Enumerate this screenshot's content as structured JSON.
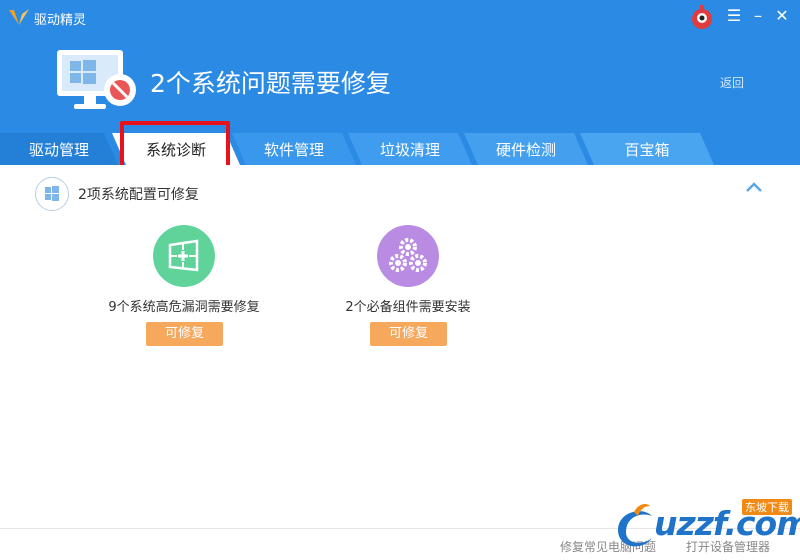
{
  "app": {
    "name": "驱动精灵"
  },
  "hero": {
    "title": "2个系统问题需要修复",
    "back_label": "返回"
  },
  "tabs": [
    {
      "label": "驱动管理"
    },
    {
      "label": "系统诊断",
      "active": true
    },
    {
      "label": "软件管理"
    },
    {
      "label": "垃圾清理"
    },
    {
      "label": "硬件检测"
    },
    {
      "label": "百宝箱"
    }
  ],
  "section": {
    "title": "2项系统配置可修复"
  },
  "cards": [
    {
      "label": "9个系统高危漏洞需要修复",
      "button": "可修复",
      "icon": "windows-shield-icon",
      "color": "#5fd39a"
    },
    {
      "label": "2个必备组件需要安装",
      "button": "可修复",
      "icon": "gears-icon",
      "color": "#b98be3"
    }
  ],
  "footer": {
    "link1": "修复常见电脑问题",
    "link2": "打开设备管理器"
  },
  "watermark": {
    "text": "uzzf.com",
    "tag": "东坡下载"
  },
  "colors": {
    "header": "#2b8ae4",
    "tab_active": "#ffffff",
    "highlight": "#e8131a",
    "button": "#f6a85d"
  }
}
